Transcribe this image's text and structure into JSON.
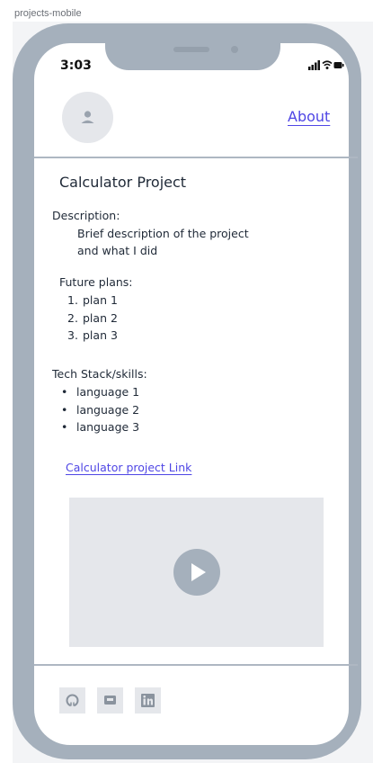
{
  "frame": {
    "label": "projects-mobile"
  },
  "status_bar": {
    "time": "3:03",
    "icons": [
      "signal-icon",
      "wifi-icon",
      "battery-icon"
    ]
  },
  "header": {
    "avatar_icon": "user-icon",
    "about_label": "About"
  },
  "project": {
    "title": "Calculator Project",
    "description_label": "Description:",
    "description_lines": [
      "Brief description of the project",
      "and what I did"
    ],
    "future_plans_label": "Future plans:",
    "future_plans": [
      "plan 1",
      "plan 2",
      "plan 3"
    ],
    "tech_label": "Tech Stack/skills:",
    "tech_items": [
      "language 1",
      "language 2",
      "language 3"
    ],
    "link_label": "Calculator project Link"
  },
  "video": {
    "icon": "play-icon"
  },
  "footer": {
    "social_icons": [
      "github-icon",
      "chat-icon",
      "linkedin-icon"
    ]
  },
  "colors": {
    "accent": "#4f46e5",
    "frame": "#a5b0bc",
    "placeholder": "#e5e7eb",
    "text": "#1f2937"
  }
}
